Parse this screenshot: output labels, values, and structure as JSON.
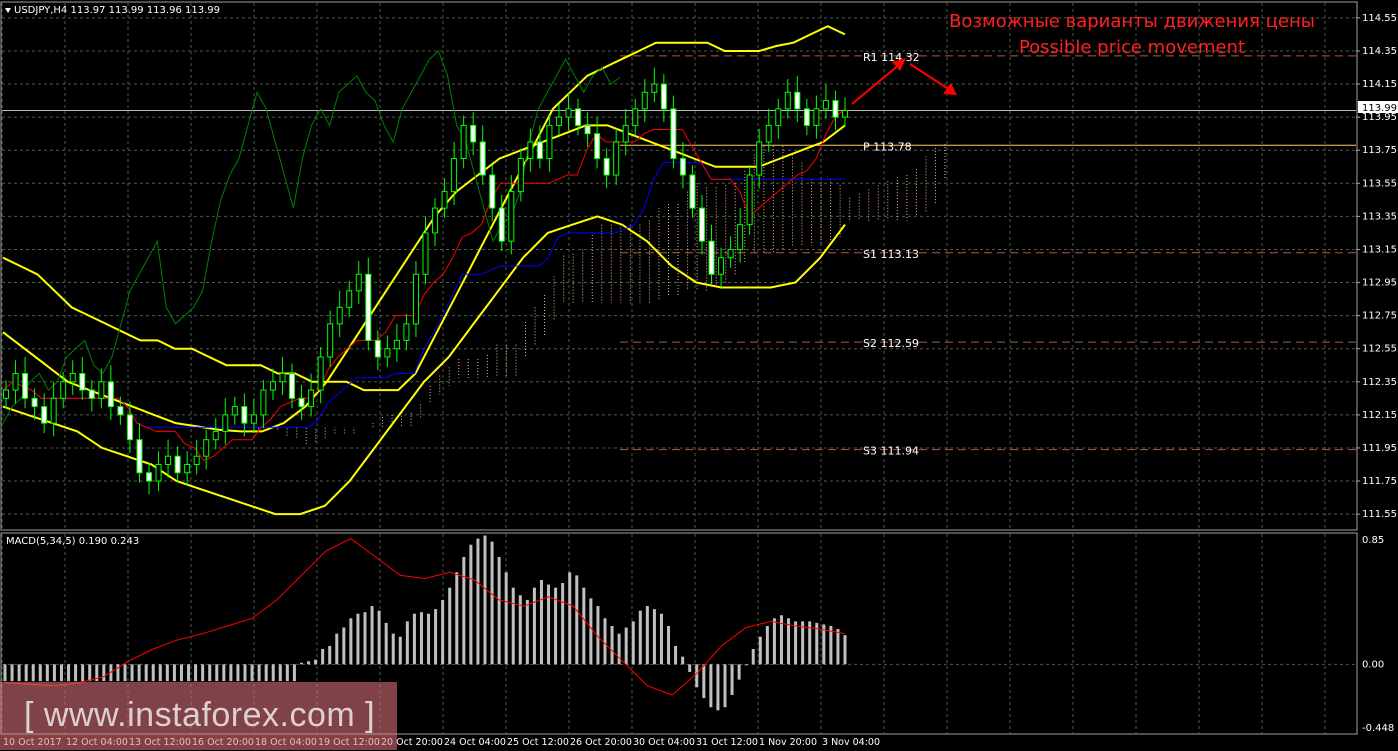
{
  "symbol_header": "USDJPY,H4  113.97 113.99 113.96 113.99",
  "annotation": {
    "ru": "Возможные варианты движения цены",
    "en": "Possible price movement"
  },
  "watermark": "[ www.instaforex.com ]",
  "current_price_label": "113.99",
  "colors": {
    "background": "#000000",
    "grid": "#4a5c4a",
    "candle": "#00ff00",
    "bollinger": "#ffff00",
    "kijun": "#0000ff",
    "tenkan": "#ff0000",
    "chikou": "#008000",
    "kumo": "#f5b895",
    "pivot": "#ffcc66",
    "support_resistance": "#b05a40",
    "arrow": "#ff0000",
    "macd_hist": "#c0c0c0",
    "macd_signal": "#ff0000",
    "annotation_text": "#ff2020"
  },
  "chart_data": [
    {
      "type": "candlestick",
      "panel": "price",
      "ylim": [
        111.46,
        114.64
      ],
      "yticks": [
        "114.55",
        "114.35",
        "114.15",
        "113.95",
        "113.75",
        "113.55",
        "113.35",
        "113.15",
        "112.95",
        "112.75",
        "112.55",
        "112.35",
        "112.15",
        "111.95",
        "111.75",
        "111.55"
      ],
      "xticks": [
        "10 Oct 2017",
        "12 Oct 04:00",
        "13 Oct 12:00",
        "16 Oct 20:00",
        "18 Oct 04:00",
        "19 Oct 12:00",
        "20 Oct 20:00",
        "24 Oct 04:00",
        "25 Oct 12:00",
        "26 Oct 20:00",
        "30 Oct 04:00",
        "31 Oct 12:00",
        "1 Nov 20:00",
        "3 Nov 04:00"
      ],
      "levels": [
        {
          "name": "R1",
          "value": 114.32,
          "label": "R1  114.32"
        },
        {
          "name": "P",
          "value": 113.78,
          "label": "P  113.78"
        },
        {
          "name": "S1",
          "value": 113.13,
          "label": "S1  113.13"
        },
        {
          "name": "S2",
          "value": 112.59,
          "label": "S2  112.59"
        },
        {
          "name": "S3",
          "value": 111.94,
          "label": "S3  111.94"
        }
      ],
      "current_price": 113.99,
      "closes": [
        112.3,
        112.4,
        112.25,
        112.2,
        112.1,
        112.25,
        112.35,
        112.4,
        112.3,
        112.25,
        112.35,
        112.2,
        112.15,
        112.0,
        111.8,
        111.75,
        111.85,
        111.9,
        111.8,
        111.85,
        111.9,
        112.0,
        112.05,
        112.15,
        112.2,
        112.1,
        112.15,
        112.3,
        112.35,
        112.4,
        112.25,
        112.2,
        112.3,
        112.5,
        112.7,
        112.8,
        112.9,
        113.0,
        112.6,
        112.5,
        112.55,
        112.6,
        112.7,
        113.0,
        113.25,
        113.4,
        113.5,
        113.7,
        113.9,
        113.8,
        113.6,
        113.4,
        113.2,
        113.5,
        113.7,
        113.8,
        113.7,
        113.9,
        113.95,
        114.0,
        113.9,
        113.85,
        113.7,
        113.6,
        113.8,
        113.9,
        114.0,
        114.1,
        114.15,
        114.0,
        113.7,
        113.6,
        113.4,
        113.2,
        113.0,
        113.1,
        113.15,
        113.3,
        113.6,
        113.8,
        113.9,
        114.0,
        114.1,
        114.0,
        113.9,
        114.0,
        114.05,
        113.95,
        113.99
      ],
      "bollinger_upper": [
        113.1,
        113.05,
        113.0,
        112.9,
        112.8,
        112.75,
        112.7,
        112.65,
        112.6,
        112.6,
        112.55,
        112.55,
        112.5,
        112.45,
        112.45,
        112.45,
        112.4,
        112.4,
        112.35,
        112.35,
        112.35,
        112.3,
        112.3,
        112.3,
        112.4,
        112.6,
        112.8,
        113.0,
        113.2,
        113.4,
        113.6,
        113.8,
        114.0,
        114.1,
        114.2,
        114.25,
        114.3,
        114.35,
        114.4,
        114.4,
        114.4,
        114.4,
        114.35,
        114.35,
        114.35,
        114.38,
        114.4,
        114.45,
        114.5,
        114.45
      ],
      "bollinger_middle": [
        112.65,
        112.55,
        112.45,
        112.35,
        112.3,
        112.25,
        112.2,
        112.15,
        112.1,
        112.08,
        112.06,
        112.05,
        112.05,
        112.1,
        112.2,
        112.35,
        112.55,
        112.75,
        112.95,
        113.15,
        113.35,
        113.5,
        113.6,
        113.7,
        113.75,
        113.8,
        113.85,
        113.9,
        113.9,
        113.85,
        113.8,
        113.75,
        113.7,
        113.65,
        113.65,
        113.65,
        113.7,
        113.75,
        113.8,
        113.9
      ],
      "bollinger_lower": [
        112.2,
        112.15,
        112.1,
        112.05,
        111.95,
        111.9,
        111.85,
        111.75,
        111.7,
        111.65,
        111.6,
        111.55,
        111.55,
        111.6,
        111.75,
        111.95,
        112.15,
        112.35,
        112.5,
        112.7,
        112.9,
        113.1,
        113.25,
        113.3,
        113.35,
        113.3,
        113.2,
        113.05,
        112.95,
        112.92,
        112.92,
        112.92,
        112.95,
        113.1,
        113.3
      ]
    },
    {
      "type": "bar",
      "panel": "indicator",
      "title": "MACD(5,34,5) 0.190 0.243",
      "ylim": [
        -0.448,
        0.85
      ],
      "yticks": [
        "0.85",
        "0.00",
        "-0.448"
      ],
      "histogram": [
        -0.11,
        -0.11,
        -0.11,
        -0.11,
        -0.11,
        -0.11,
        -0.11,
        -0.11,
        -0.11,
        -0.11,
        -0.11,
        -0.11,
        -0.11,
        -0.11,
        -0.11,
        -0.11,
        -0.11,
        -0.11,
        -0.11,
        -0.11,
        -0.11,
        -0.11,
        -0.11,
        -0.11,
        -0.11,
        -0.11,
        -0.11,
        -0.11,
        -0.11,
        -0.11,
        -0.11,
        -0.11,
        -0.11,
        -0.11,
        -0.11,
        -0.11,
        -0.11,
        -0.11,
        -0.11,
        -0.11,
        -0.11,
        -0.11,
        0.01,
        0.02,
        0.03,
        0.1,
        0.12,
        0.2,
        0.24,
        0.3,
        0.33,
        0.34,
        0.38,
        0.35,
        0.27,
        0.2,
        0.18,
        0.28,
        0.33,
        0.34,
        0.33,
        0.36,
        0.42,
        0.5,
        0.6,
        0.7,
        0.78,
        0.82,
        0.84,
        0.8,
        0.7,
        0.6,
        0.5,
        0.45,
        0.42,
        0.5,
        0.55,
        0.52,
        0.5,
        0.53,
        0.6,
        0.58,
        0.5,
        0.43,
        0.38,
        0.3,
        0.25,
        0.2,
        0.24,
        0.28,
        0.35,
        0.38,
        0.36,
        0.33,
        0.25,
        0.12,
        0.05,
        -0.05,
        -0.15,
        -0.22,
        -0.28,
        -0.3,
        -0.28,
        -0.2,
        -0.1,
        0.0,
        0.1,
        0.18,
        0.25,
        0.3,
        0.32,
        0.3,
        0.28,
        0.28,
        0.28,
        0.27,
        0.26,
        0.25,
        0.23,
        0.19
      ],
      "signal": [
        -0.12,
        -0.13,
        -0.14,
        -0.12,
        -0.08,
        0.02,
        0.1,
        0.16,
        0.2,
        0.25,
        0.3,
        0.42,
        0.58,
        0.74,
        0.82,
        0.7,
        0.58,
        0.56,
        0.6,
        0.55,
        0.42,
        0.38,
        0.44,
        0.38,
        0.18,
        0.02,
        -0.14,
        -0.2,
        -0.06,
        0.12,
        0.24,
        0.28,
        0.25,
        0.23,
        0.2
      ]
    }
  ]
}
